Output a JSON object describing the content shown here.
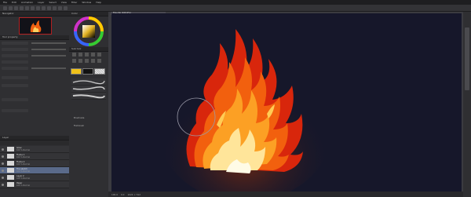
{
  "app": {
    "menu": [
      "File",
      "Edit",
      "Animation",
      "Layer",
      "Select",
      "View",
      "Filter",
      "Window",
      "Help"
    ],
    "document_tab": "Fire.clip (100.0%)"
  },
  "left_panel": {
    "navigator_label": "Navigator",
    "tool_property_label": "Tool property",
    "layer_panel_label": "Layer",
    "layers": [
      {
        "name": "Glow",
        "blend": "100 % Normal"
      },
      {
        "name": "Flame 1",
        "blend": "100 % Normal"
      },
      {
        "name": "Flame 2",
        "blend": "100 % Normal"
      },
      {
        "name": "Fire sketch",
        "blend": "100 % Normal"
      },
      {
        "name": "Layer 2",
        "blend": "100 % Normal"
      },
      {
        "name": "Paper",
        "blend": "100 % Normal"
      }
    ]
  },
  "mid_panel": {
    "color_label": "Color",
    "subtool_label": "Sub tool",
    "brush_labels": [
      "Brush",
      "Brush",
      "Brush"
    ],
    "brush_size_label": "Brush size",
    "flat_brush_label": "Flat brush"
  },
  "colors": {
    "main": "#f0c21a",
    "sub": "#111111",
    "canvas_bg": "#16172a",
    "selection": "#5a6a8a"
  },
  "status": {
    "zoom": "100.0",
    "angle": "0.0",
    "coords": "1024 × 512"
  }
}
